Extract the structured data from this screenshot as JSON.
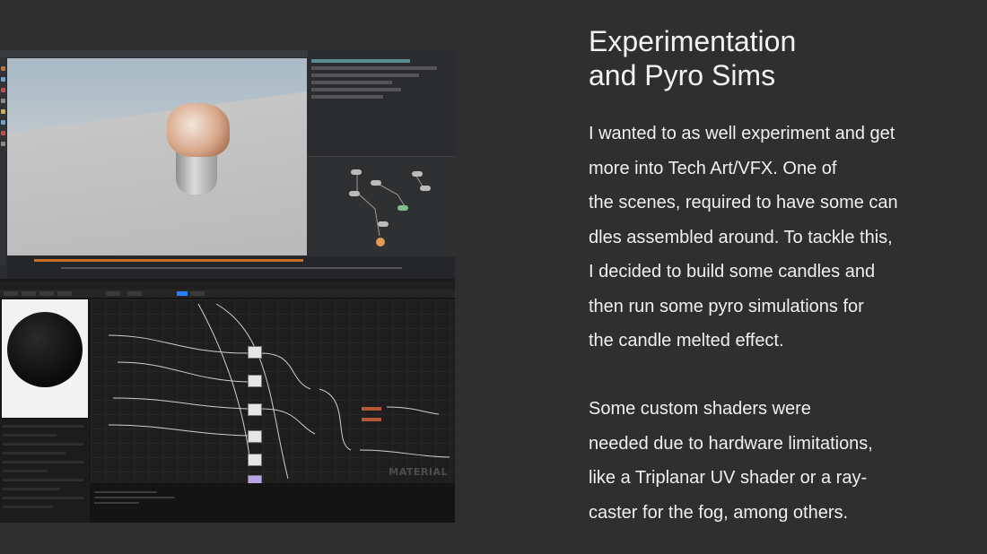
{
  "slide": {
    "title_lines": [
      "Experimentation",
      "and Pyro Sims"
    ],
    "paragraph_1_lines": [
      "I wanted to as well experiment and get",
      "more into Tech Art/VFX. One of",
      "the scenes, required to have some can",
      "dles assembled around. To tackle this,",
      "I decided to build some candles and",
      "then run some pyro simulations for",
      "the candle melted effect."
    ],
    "paragraph_2_lines": [
      "Some custom shaders were",
      "needed due to hardware limitations,",
      "like a Triplanar UV shader or a ray-",
      "caster for the fog, among others."
    ]
  },
  "screenshot_2": {
    "watermark": "MATERIAL"
  },
  "colors": {
    "background": "#2f2f2f",
    "text": "#f0f0f0",
    "timeline_accent": "#c8702a",
    "unreal_accent": "#2a7fff"
  }
}
